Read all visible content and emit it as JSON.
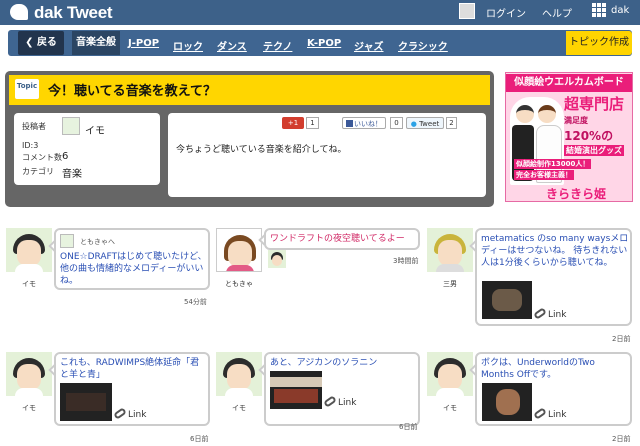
{
  "app": {
    "logo": "dak Tweet"
  },
  "header": {
    "login_label": "ログイン",
    "help_label": "ヘルプ",
    "user_label": "dak"
  },
  "nav": {
    "back_label": "戻る",
    "categories": [
      "音楽全般",
      "J-POP",
      "ロック",
      "ダンス",
      "テクノ",
      "K-POP",
      "ジャズ",
      "クラシック"
    ],
    "create_label": "トピック作成"
  },
  "topic": {
    "badge": "Topic",
    "title": "今！聴いてる音楽を教えて？",
    "poster_label": "投稿者",
    "poster_name": "イモ",
    "id_text": "ID:3",
    "comment_label": "コメント数",
    "comment_count": "6",
    "category_label": "カテゴリ",
    "category_value": "音楽",
    "body": "今ちょうど聴いている音楽を紹介してね。",
    "gplus_label": "+1",
    "gplus_count": "1",
    "like_label": "いいね！",
    "like_count": "0",
    "tweet_label": "Tweet",
    "tweet_count": "2"
  },
  "ad": {
    "title": "似顔絵ウエルカムボード",
    "line1": "超専門店",
    "line2": "満足度",
    "line3": "120%の",
    "line4": "結婚演出グッズ",
    "line5": "似顔絵制作13000人！",
    "line6": "完全お客様主義！",
    "foot": "きらきら姫"
  },
  "posts": [
    {
      "author": "イモ",
      "reply_to": "ともきゃへ",
      "text": "ONE☆DRAFTはじめて聴いたけど、他の曲も情緒的なメロディーがいいね。",
      "time": "54分前"
    },
    {
      "author": "ともきゃ",
      "text": "ワンドラフトの夜空聴いてるよー",
      "time": "3時間前"
    },
    {
      "author": "三男",
      "text": "metamatics のso many waysメロディーはせつないね。 待ちきれない人は1分後くらいから聴いてね。",
      "link": "Link",
      "time": "2日前"
    },
    {
      "author": "イモ",
      "text": "これも、RADWIMPS絶体延命「君と羊と青」",
      "link": "Link",
      "time": "6日前"
    },
    {
      "author": "イモ",
      "text": "あと、アジカンのソラニン",
      "link": "Link",
      "time": "6日前"
    },
    {
      "author": "イモ",
      "text": "ボクは、UnderworldのTwo Months Offです。",
      "link": "Link",
      "time": "2日前"
    }
  ],
  "colors": {
    "header": "#3d6189",
    "accent_yellow": "#ffd600",
    "link_blue": "#2a4fb4",
    "pink": "#ea1e7a"
  }
}
